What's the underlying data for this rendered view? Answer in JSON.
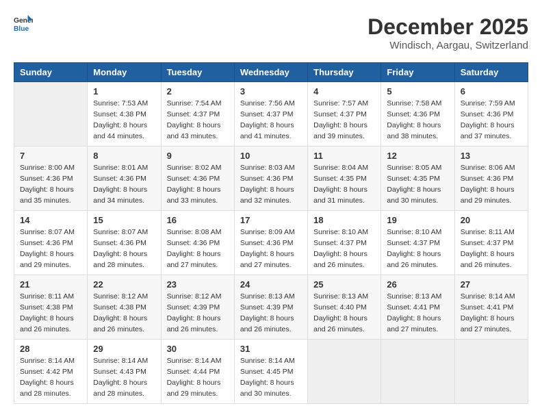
{
  "logo": {
    "text_general": "General",
    "text_blue": "Blue"
  },
  "title": {
    "month": "December 2025",
    "location": "Windisch, Aargau, Switzerland"
  },
  "weekdays": [
    "Sunday",
    "Monday",
    "Tuesday",
    "Wednesday",
    "Thursday",
    "Friday",
    "Saturday"
  ],
  "weeks": [
    [
      {
        "day": "",
        "sunrise": "",
        "sunset": "",
        "daylight": ""
      },
      {
        "day": "1",
        "sunrise": "Sunrise: 7:53 AM",
        "sunset": "Sunset: 4:38 PM",
        "daylight": "Daylight: 8 hours and 44 minutes."
      },
      {
        "day": "2",
        "sunrise": "Sunrise: 7:54 AM",
        "sunset": "Sunset: 4:37 PM",
        "daylight": "Daylight: 8 hours and 43 minutes."
      },
      {
        "day": "3",
        "sunrise": "Sunrise: 7:56 AM",
        "sunset": "Sunset: 4:37 PM",
        "daylight": "Daylight: 8 hours and 41 minutes."
      },
      {
        "day": "4",
        "sunrise": "Sunrise: 7:57 AM",
        "sunset": "Sunset: 4:37 PM",
        "daylight": "Daylight: 8 hours and 39 minutes."
      },
      {
        "day": "5",
        "sunrise": "Sunrise: 7:58 AM",
        "sunset": "Sunset: 4:36 PM",
        "daylight": "Daylight: 8 hours and 38 minutes."
      },
      {
        "day": "6",
        "sunrise": "Sunrise: 7:59 AM",
        "sunset": "Sunset: 4:36 PM",
        "daylight": "Daylight: 8 hours and 37 minutes."
      }
    ],
    [
      {
        "day": "7",
        "sunrise": "Sunrise: 8:00 AM",
        "sunset": "Sunset: 4:36 PM",
        "daylight": "Daylight: 8 hours and 35 minutes."
      },
      {
        "day": "8",
        "sunrise": "Sunrise: 8:01 AM",
        "sunset": "Sunset: 4:36 PM",
        "daylight": "Daylight: 8 hours and 34 minutes."
      },
      {
        "day": "9",
        "sunrise": "Sunrise: 8:02 AM",
        "sunset": "Sunset: 4:36 PM",
        "daylight": "Daylight: 8 hours and 33 minutes."
      },
      {
        "day": "10",
        "sunrise": "Sunrise: 8:03 AM",
        "sunset": "Sunset: 4:36 PM",
        "daylight": "Daylight: 8 hours and 32 minutes."
      },
      {
        "day": "11",
        "sunrise": "Sunrise: 8:04 AM",
        "sunset": "Sunset: 4:35 PM",
        "daylight": "Daylight: 8 hours and 31 minutes."
      },
      {
        "day": "12",
        "sunrise": "Sunrise: 8:05 AM",
        "sunset": "Sunset: 4:35 PM",
        "daylight": "Daylight: 8 hours and 30 minutes."
      },
      {
        "day": "13",
        "sunrise": "Sunrise: 8:06 AM",
        "sunset": "Sunset: 4:36 PM",
        "daylight": "Daylight: 8 hours and 29 minutes."
      }
    ],
    [
      {
        "day": "14",
        "sunrise": "Sunrise: 8:07 AM",
        "sunset": "Sunset: 4:36 PM",
        "daylight": "Daylight: 8 hours and 29 minutes."
      },
      {
        "day": "15",
        "sunrise": "Sunrise: 8:07 AM",
        "sunset": "Sunset: 4:36 PM",
        "daylight": "Daylight: 8 hours and 28 minutes."
      },
      {
        "day": "16",
        "sunrise": "Sunrise: 8:08 AM",
        "sunset": "Sunset: 4:36 PM",
        "daylight": "Daylight: 8 hours and 27 minutes."
      },
      {
        "day": "17",
        "sunrise": "Sunrise: 8:09 AM",
        "sunset": "Sunset: 4:36 PM",
        "daylight": "Daylight: 8 hours and 27 minutes."
      },
      {
        "day": "18",
        "sunrise": "Sunrise: 8:10 AM",
        "sunset": "Sunset: 4:37 PM",
        "daylight": "Daylight: 8 hours and 26 minutes."
      },
      {
        "day": "19",
        "sunrise": "Sunrise: 8:10 AM",
        "sunset": "Sunset: 4:37 PM",
        "daylight": "Daylight: 8 hours and 26 minutes."
      },
      {
        "day": "20",
        "sunrise": "Sunrise: 8:11 AM",
        "sunset": "Sunset: 4:37 PM",
        "daylight": "Daylight: 8 hours and 26 minutes."
      }
    ],
    [
      {
        "day": "21",
        "sunrise": "Sunrise: 8:11 AM",
        "sunset": "Sunset: 4:38 PM",
        "daylight": "Daylight: 8 hours and 26 minutes."
      },
      {
        "day": "22",
        "sunrise": "Sunrise: 8:12 AM",
        "sunset": "Sunset: 4:38 PM",
        "daylight": "Daylight: 8 hours and 26 minutes."
      },
      {
        "day": "23",
        "sunrise": "Sunrise: 8:12 AM",
        "sunset": "Sunset: 4:39 PM",
        "daylight": "Daylight: 8 hours and 26 minutes."
      },
      {
        "day": "24",
        "sunrise": "Sunrise: 8:13 AM",
        "sunset": "Sunset: 4:39 PM",
        "daylight": "Daylight: 8 hours and 26 minutes."
      },
      {
        "day": "25",
        "sunrise": "Sunrise: 8:13 AM",
        "sunset": "Sunset: 4:40 PM",
        "daylight": "Daylight: 8 hours and 26 minutes."
      },
      {
        "day": "26",
        "sunrise": "Sunrise: 8:13 AM",
        "sunset": "Sunset: 4:41 PM",
        "daylight": "Daylight: 8 hours and 27 minutes."
      },
      {
        "day": "27",
        "sunrise": "Sunrise: 8:14 AM",
        "sunset": "Sunset: 4:41 PM",
        "daylight": "Daylight: 8 hours and 27 minutes."
      }
    ],
    [
      {
        "day": "28",
        "sunrise": "Sunrise: 8:14 AM",
        "sunset": "Sunset: 4:42 PM",
        "daylight": "Daylight: 8 hours and 28 minutes."
      },
      {
        "day": "29",
        "sunrise": "Sunrise: 8:14 AM",
        "sunset": "Sunset: 4:43 PM",
        "daylight": "Daylight: 8 hours and 28 minutes."
      },
      {
        "day": "30",
        "sunrise": "Sunrise: 8:14 AM",
        "sunset": "Sunset: 4:44 PM",
        "daylight": "Daylight: 8 hours and 29 minutes."
      },
      {
        "day": "31",
        "sunrise": "Sunrise: 8:14 AM",
        "sunset": "Sunset: 4:45 PM",
        "daylight": "Daylight: 8 hours and 30 minutes."
      },
      {
        "day": "",
        "sunrise": "",
        "sunset": "",
        "daylight": ""
      },
      {
        "day": "",
        "sunrise": "",
        "sunset": "",
        "daylight": ""
      },
      {
        "day": "",
        "sunrise": "",
        "sunset": "",
        "daylight": ""
      }
    ]
  ]
}
